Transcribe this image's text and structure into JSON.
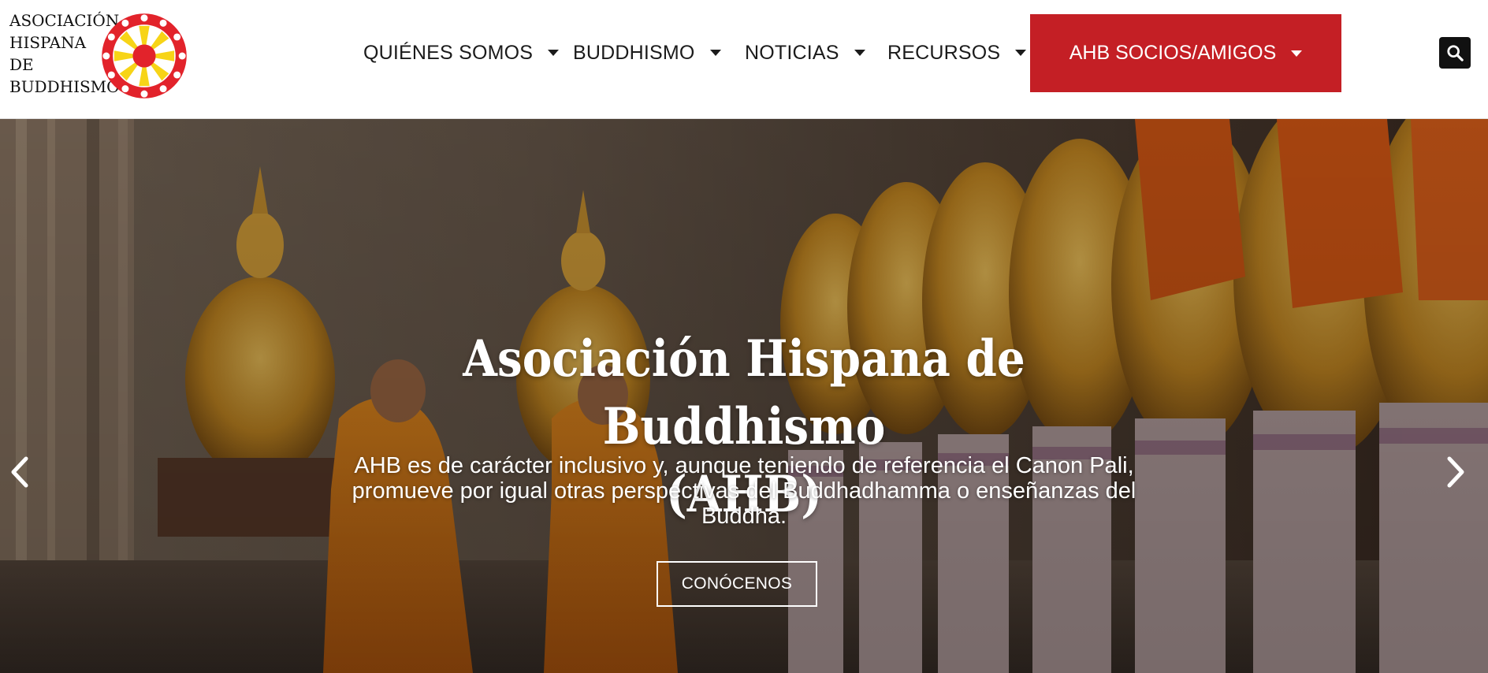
{
  "brand": {
    "lines": [
      "ASOCIACIÓN",
      "HISPANA",
      "DE",
      "BUDDHISMO"
    ],
    "colors": {
      "red": "#e2232b",
      "yellow": "#f7d417"
    }
  },
  "nav": {
    "items": [
      {
        "label": "QUIÉNES SOMOS"
      },
      {
        "label": "BUDDHISMO"
      },
      {
        "label": "NOTICIAS"
      },
      {
        "label": "RECURSOS"
      }
    ],
    "cta": {
      "label": "AHB SOCIOS/AMIGOS",
      "color": "#c41f25"
    },
    "search_icon": "search-icon"
  },
  "hero": {
    "title_line1": "Asociación Hispana de Buddhismo",
    "title_line2": "(AHB)",
    "subtitle_line1": "AHB es de carácter inclusivo y, aunque teniendo de referencia el Canon Pali,",
    "subtitle_line2": "promueve por igual otras perspectivas del Buddhadhamma o enseñanzas del",
    "subtitle_line3": "Buddha.",
    "button": "CONÓCENOS",
    "prev_icon": "chevron-left-icon",
    "next_icon": "chevron-right-icon"
  }
}
